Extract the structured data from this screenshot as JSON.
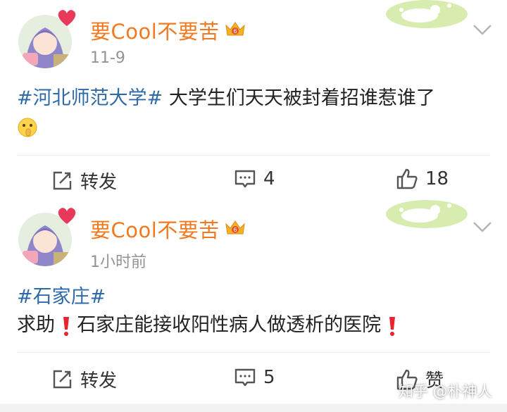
{
  "posts": [
    {
      "username": "要Cool不要苦",
      "time": "11-9",
      "hashtag": "#河北师范大学#",
      "text": " 大学生们天天被封着招谁惹谁了",
      "emoji_icon": "shush-emoji-icon",
      "actions": {
        "repost": "转发",
        "comment": "4",
        "like": "18"
      }
    },
    {
      "username": "要Cool不要苦",
      "time": "1小时前",
      "hashtag": "#石家庄#",
      "text_before": "求助",
      "text_middle": "石家庄能接收阳性病人做透析的医院",
      "mark_icon": "red-exclamation-icon",
      "actions": {
        "repost": "转发",
        "comment": "5",
        "like": "赞"
      }
    }
  ],
  "watermark": "知乎 @朴神人",
  "colors": {
    "username": "#f2791f",
    "hashtag": "#2f6aa8",
    "time": "#939393",
    "exclaim": "#e8242f"
  }
}
